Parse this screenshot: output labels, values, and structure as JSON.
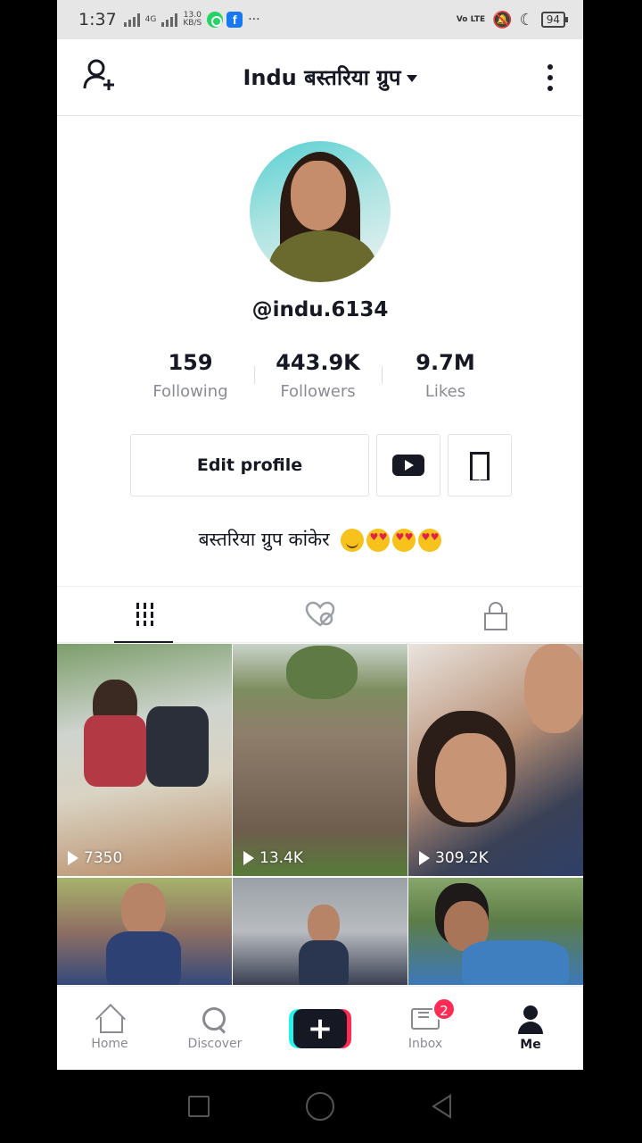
{
  "status_bar": {
    "time": "1:37",
    "net_top": "4G",
    "speed_value": "13.0",
    "speed_unit": "KB/S",
    "dots": "···",
    "volte": "Vo LTE",
    "battery": "94"
  },
  "header": {
    "title": "Indu  बस्तरिया ग्रुप",
    "add_friend_icon": "person-plus-icon",
    "menu_icon": "three-dots-icon"
  },
  "profile": {
    "username": "@indu.6134",
    "stats": [
      {
        "value": "159",
        "label": "Following"
      },
      {
        "value": "443.9K",
        "label": "Followers"
      },
      {
        "value": "9.7M",
        "label": "Likes"
      }
    ],
    "edit_button": "Edit profile",
    "bio": "बस्तरिया ग्रुप कांकेर"
  },
  "tabs": [
    {
      "icon": "grid-icon",
      "active": true
    },
    {
      "icon": "liked-videos-icon",
      "active": false
    },
    {
      "icon": "lock-icon",
      "active": false
    }
  ],
  "videos": [
    {
      "views": "7350"
    },
    {
      "views": "13.4K"
    },
    {
      "views": "309.2K"
    },
    {
      "views": ""
    },
    {
      "views": ""
    },
    {
      "views": ""
    }
  ],
  "bottom_nav": {
    "home": "Home",
    "discover": "Discover",
    "inbox": "Inbox",
    "inbox_badge": "2",
    "me": "Me"
  },
  "colors": {
    "accent_pink": "#fe2c55",
    "accent_cyan": "#25f4ee",
    "text_dark": "#161823",
    "text_muted": "#8a8b91"
  }
}
